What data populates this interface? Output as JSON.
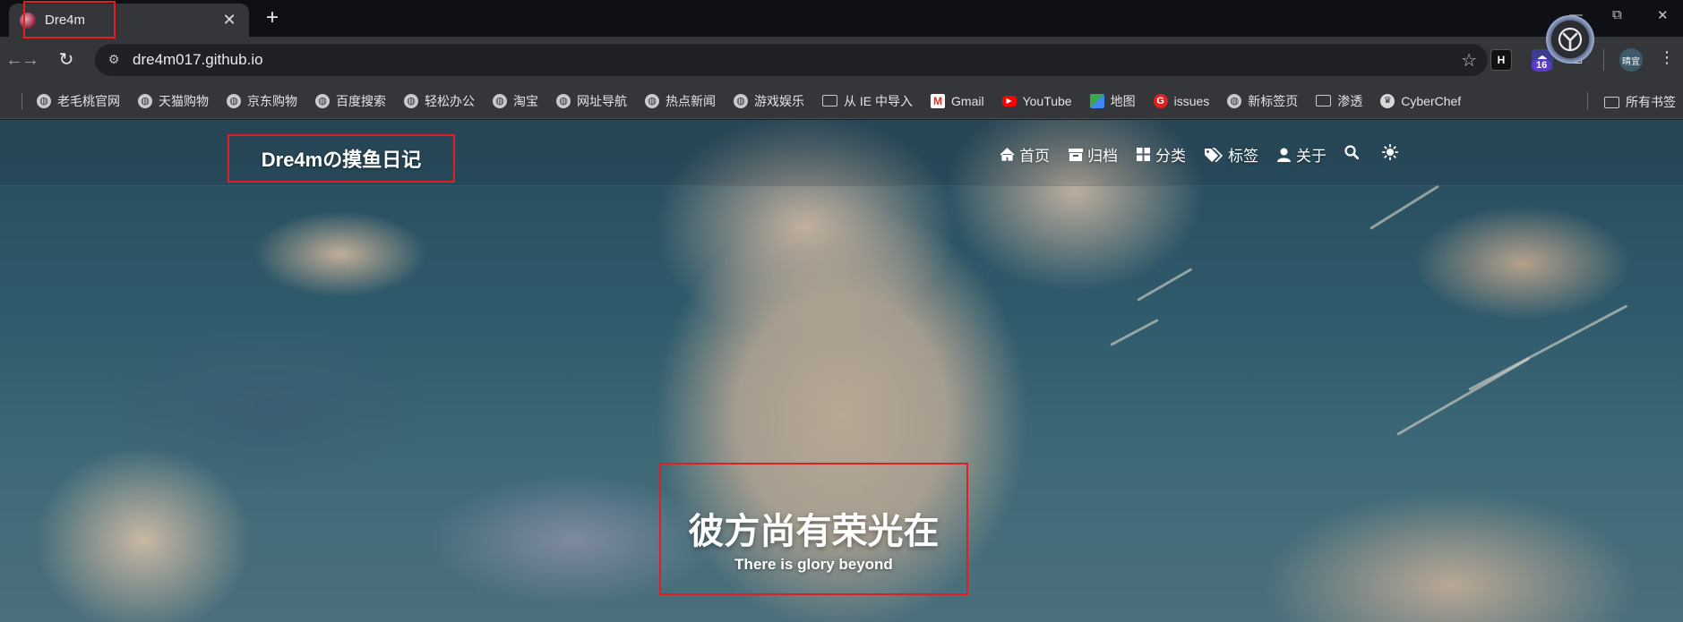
{
  "browser": {
    "tab": {
      "title": "Dre4m",
      "close_glyph": "✕"
    },
    "new_tab_glyph": "+",
    "window_controls": {
      "minimize": "—",
      "restore": "⧉",
      "close": "✕"
    },
    "toolbar": {
      "url": "dre4m017.github.io",
      "extension_badge": "16",
      "extension_h": "H",
      "profile_label": "晴宜"
    },
    "bookmarks": [
      {
        "label": "老毛桃官网",
        "icon": "globe-icon"
      },
      {
        "label": "天猫购物",
        "icon": "globe-icon"
      },
      {
        "label": "京东购物",
        "icon": "globe-icon"
      },
      {
        "label": "百度搜索",
        "icon": "globe-icon"
      },
      {
        "label": "轻松办公",
        "icon": "globe-icon"
      },
      {
        "label": "淘宝",
        "icon": "globe-icon"
      },
      {
        "label": "网址导航",
        "icon": "globe-icon"
      },
      {
        "label": "热点新闻",
        "icon": "globe-icon"
      },
      {
        "label": "游戏娱乐",
        "icon": "globe-icon"
      },
      {
        "label": "从 IE 中导入",
        "icon": "folder-icon"
      },
      {
        "label": "Gmail",
        "icon": "gmail-icon"
      },
      {
        "label": "YouTube",
        "icon": "youtube-icon"
      },
      {
        "label": "地图",
        "icon": "maps-icon"
      },
      {
        "label": "issues",
        "icon": "g-icon"
      },
      {
        "label": "新标签页",
        "icon": "globe-icon"
      },
      {
        "label": "渗透",
        "icon": "folder-icon"
      },
      {
        "label": "CyberChef",
        "icon": "chef-icon"
      }
    ],
    "all_bookmarks": "所有书签"
  },
  "site": {
    "title": "Dre4mの摸鱼日记",
    "nav": [
      {
        "label": "首页",
        "icon": "home-icon"
      },
      {
        "label": "归档",
        "icon": "archive-icon"
      },
      {
        "label": "分类",
        "icon": "grid-icon"
      },
      {
        "label": "标签",
        "icon": "tags-icon"
      },
      {
        "label": "关于",
        "icon": "user-icon"
      }
    ],
    "hero": {
      "title": "彼方尚有荣光在",
      "subtitle": "There is glory beyond"
    }
  },
  "colors": {
    "highlight_box": "#e02020",
    "tab_bg": "#35363a",
    "tabstrip_bg": "#0f1015"
  }
}
